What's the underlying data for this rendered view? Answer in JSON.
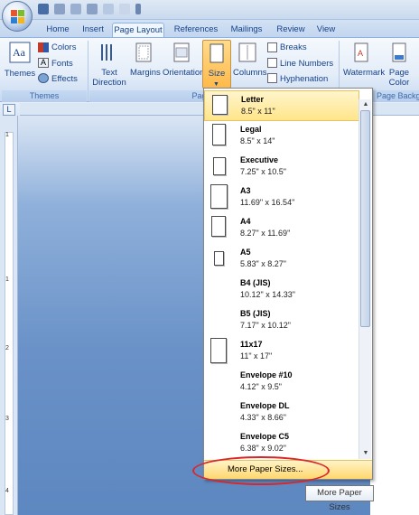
{
  "tabs": [
    "Home",
    "Insert",
    "Page Layout",
    "References",
    "Mailings",
    "Review",
    "View"
  ],
  "ribbon": {
    "themes": {
      "label": "Themes",
      "colors": "Colors",
      "fonts": "Fonts",
      "effects": "Effects",
      "group": "Themes"
    },
    "text_direction": "Text\nDirection",
    "margins": "Margins",
    "orientation": "Orientation",
    "size": "Size",
    "columns": "Columns",
    "breaks": "Breaks",
    "line_numbers": "Line Numbers",
    "hyphenation": "Hyphenation",
    "page_setup_group": "Page Setup",
    "watermark": "Watermark",
    "page_color": "Page\nColor",
    "page_background_group": "Page Background"
  },
  "paper_sizes": [
    {
      "name": "Letter",
      "dim": "8.5\" x 11\""
    },
    {
      "name": "Legal",
      "dim": "8.5\" x 14\""
    },
    {
      "name": "Executive",
      "dim": "7.25\" x 10.5\""
    },
    {
      "name": "A3",
      "dim": "11.69\" x 16.54\""
    },
    {
      "name": "A4",
      "dim": "8.27\" x 11.69\""
    },
    {
      "name": "A5",
      "dim": "5.83\" x 8.27\""
    },
    {
      "name": "B4 (JIS)",
      "dim": "10.12\" x 14.33\""
    },
    {
      "name": "B5 (JIS)",
      "dim": "7.17\" x 10.12\""
    },
    {
      "name": "11x17",
      "dim": "11\" x 17\""
    },
    {
      "name": "Envelope #10",
      "dim": "4.12\" x 9.5\""
    },
    {
      "name": "Envelope DL",
      "dim": "4.33\" x 8.66\""
    },
    {
      "name": "Envelope C5",
      "dim": "6.38\" x 9.02\""
    }
  ],
  "more_paper_sizes": "More Paper Sizes...",
  "tooltip": "More Paper Sizes",
  "ruler_tab_selector": "L",
  "ruler_numbers": [
    "1",
    "1",
    "2",
    "3",
    "4"
  ]
}
